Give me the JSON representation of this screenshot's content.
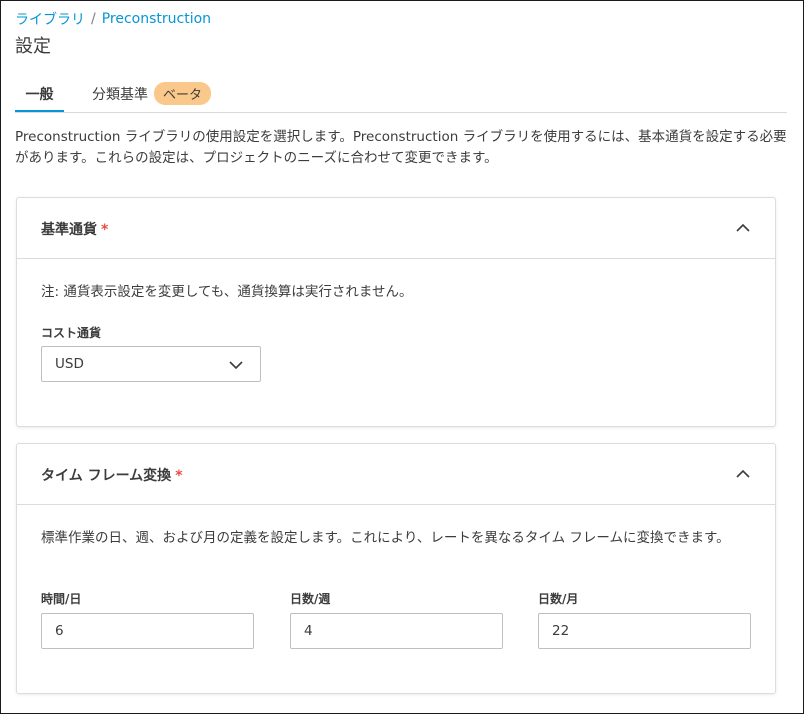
{
  "breadcrumb": {
    "library": "ライブラリ",
    "separator": "/",
    "current": "Preconstruction"
  },
  "page": {
    "title": "設定"
  },
  "tabs": [
    {
      "label": "一般",
      "active": true
    },
    {
      "label": "分類基準",
      "badge": "ベータ",
      "active": false
    }
  ],
  "intro": "Preconstruction ライブラリの使用設定を選択します。Preconstruction ライブラリを使用するには、基本通貨を設定する必要があります。これらの設定は、プロジェクトのニーズに合わせて変更できます。",
  "currency_card": {
    "title": "基準通貨",
    "required_mark": "*",
    "note": "注: 通貨表示設定を変更しても、通貨換算は実行されません。",
    "cost_currency_label": "コスト通貨",
    "cost_currency_value": "USD"
  },
  "timeframe_card": {
    "title": "タイム フレーム変換",
    "required_mark": "*",
    "description": "標準作業の日、週、および月の定義を設定します。これにより、レートを異なるタイム フレームに変換できます。",
    "fields": [
      {
        "label": "時間/日",
        "value": "6"
      },
      {
        "label": "日数/週",
        "value": "4"
      },
      {
        "label": "日数/月",
        "value": "22"
      }
    ]
  },
  "colors": {
    "accent": "#0696d7",
    "required": "#ec4a41",
    "beta_badge": "#f9c88a"
  }
}
